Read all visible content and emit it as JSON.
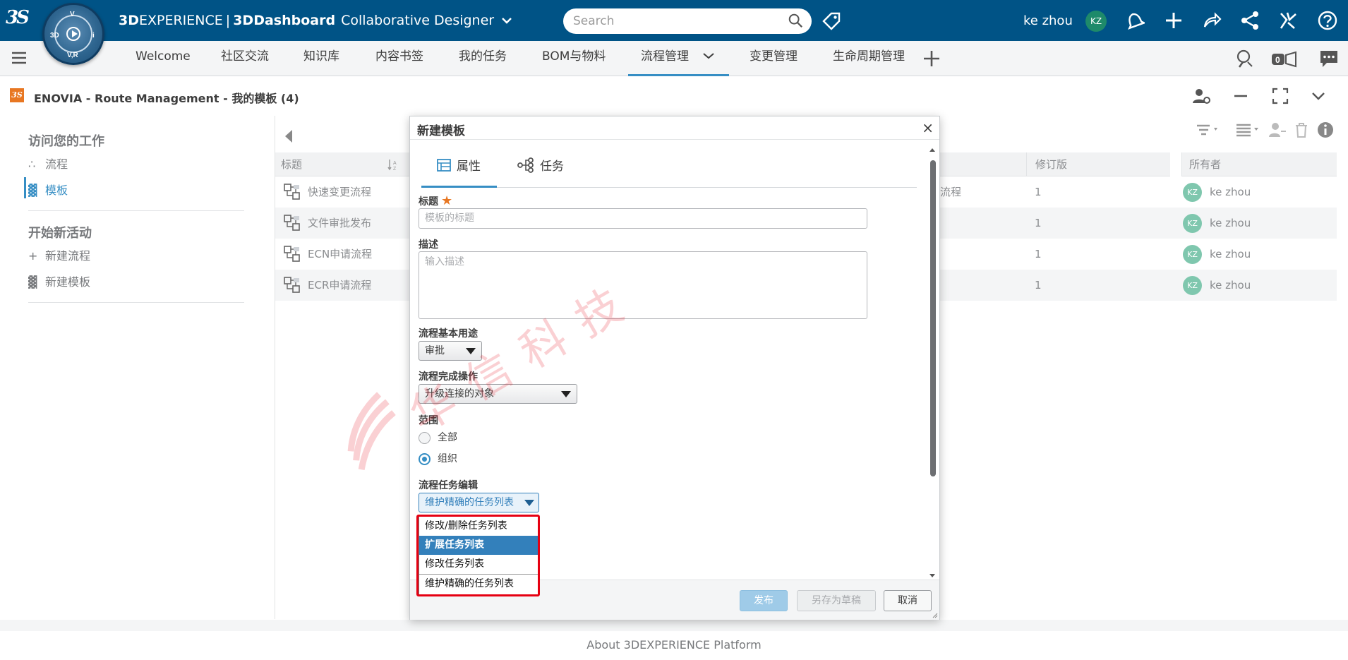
{
  "topbar": {
    "brand_3d": "3D",
    "brand_experience": "EXPERIENCE",
    "brand_sep": "|",
    "brand_3d2": "3D",
    "brand_dashboard": "Dashboard",
    "brand_app": "Collaborative Designer",
    "compass_top": "V",
    "compass_left": "3D",
    "compass_right": "i",
    "compass_bottom": "V,R",
    "search_placeholder": "Search",
    "user_name": "ke zhou",
    "user_initials": "KZ"
  },
  "nav": {
    "tabs": [
      "Welcome",
      "社区交流",
      "知识库",
      "内容书签",
      "我的任务",
      "BOM与物料",
      "流程管理",
      "变更管理",
      "生命周期管理"
    ],
    "active_index": 6
  },
  "widget": {
    "title": "ENOVIA - Route Management - 我的模板 (4)",
    "logo_text": "3S"
  },
  "left_panel": {
    "section1_title": "访问您的工作",
    "item_routes": "流程",
    "item_templates": "模板",
    "section2_title": "开始新活动",
    "item_new_route": "新建流程",
    "item_new_template": "新建模板"
  },
  "table": {
    "headers": [
      "标题",
      "修订版",
      "所有者"
    ],
    "rows": [
      {
        "title": "快速变更流程",
        "partial": "流程",
        "revision": "1",
        "owner": "ke zhou",
        "initials": "KZ"
      },
      {
        "title": "文件审批发布",
        "partial": "",
        "revision": "1",
        "owner": "ke zhou",
        "initials": "KZ"
      },
      {
        "title": "ECN申请流程",
        "partial": "",
        "revision": "1",
        "owner": "ke zhou",
        "initials": "KZ"
      },
      {
        "title": "ECR申请流程",
        "partial": "",
        "revision": "1",
        "owner": "ke zhou",
        "initials": "KZ"
      }
    ]
  },
  "modal": {
    "title": "新建模板",
    "close": "×",
    "tab_properties": "属性",
    "tab_tasks": "任务",
    "label_title": "标题",
    "required_star": "★",
    "title_placeholder": "模板的标题",
    "label_description": "描述",
    "description_placeholder": "输入描述",
    "label_purpose": "流程基本用途",
    "purpose_value": "审批",
    "label_completion": "流程完成操作",
    "completion_value": "升级连接的对象",
    "label_scope": "范围",
    "scope_all": "全部",
    "scope_org": "组织",
    "label_task_edit": "流程任务编辑",
    "task_edit_value": "维护精确的任务列表",
    "dropdown_options": [
      "修改/删除任务列表",
      "扩展任务列表",
      "修改任务列表",
      "维护精确的任务列表"
    ],
    "dropdown_highlight_index": 1,
    "btn_publish": "发布",
    "btn_draft": "另存为草稿",
    "btn_cancel": "取消"
  },
  "watermark": "华信科技",
  "footer": "About 3DEXPERIENCE Platform",
  "colors": {
    "topbar": "#005386",
    "accent": "#368ec4",
    "highlight_border": "#e60012",
    "brand_orange": "#e87722"
  }
}
